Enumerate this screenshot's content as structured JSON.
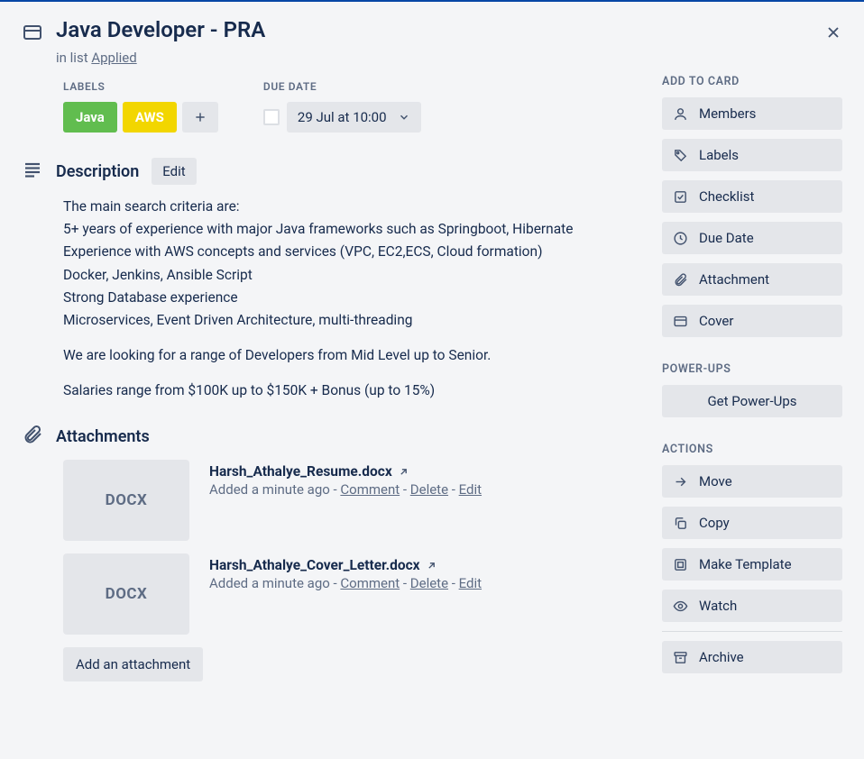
{
  "card": {
    "title": "Java Developer - PRA",
    "in_list_prefix": "in list ",
    "list_name": "Applied"
  },
  "meta": {
    "labels_title": "LABELS",
    "labels": {
      "java": "Java",
      "aws": "AWS"
    },
    "due_title": "DUE DATE",
    "due_value": "29 Jul at 10:00"
  },
  "description": {
    "title": "Description",
    "edit": "Edit",
    "para1": "The main search criteria are:\n5+ years of experience with major Java frameworks such as Springboot, Hibernate\nExperience with AWS concepts and services (VPC, EC2,ECS, Cloud formation)\nDocker, Jenkins, Ansible Script\nStrong Database experience\nMicroservices, Event Driven Architecture, multi-threading",
    "para2": "We are looking for a range of Developers from Mid Level up to Senior.",
    "para3": "Salaries range from $100K up to $150K + Bonus (up to 15%)"
  },
  "attachments": {
    "title": "Attachments",
    "items": [
      {
        "ext": "DOCX",
        "name": "Harsh_Athalye_Resume.docx",
        "added": "Added a minute ago",
        "comment": "Comment",
        "delete": "Delete",
        "edit": "Edit"
      },
      {
        "ext": "DOCX",
        "name": "Harsh_Athalye_Cover_Letter.docx",
        "added": "Added a minute ago",
        "comment": "Comment",
        "delete": "Delete",
        "edit": "Edit"
      }
    ],
    "add_button": "Add an attachment"
  },
  "sidebar": {
    "add_to_card": {
      "title": "ADD TO CARD",
      "members": "Members",
      "labels": "Labels",
      "checklist": "Checklist",
      "due_date": "Due Date",
      "attachment": "Attachment",
      "cover": "Cover"
    },
    "powerups": {
      "title": "POWER-UPS",
      "get": "Get Power-Ups"
    },
    "actions": {
      "title": "ACTIONS",
      "move": "Move",
      "copy": "Copy",
      "make_template": "Make Template",
      "watch": "Watch",
      "archive": "Archive"
    }
  }
}
